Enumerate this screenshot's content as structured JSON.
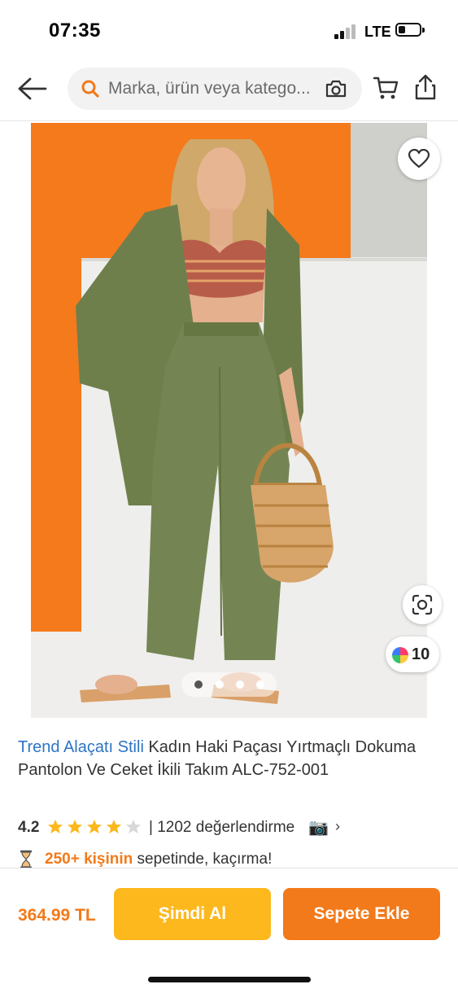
{
  "status_bar": {
    "time": "07:35",
    "network": "LTE"
  },
  "search": {
    "placeholder": "Marka, ürün veya katego..."
  },
  "icons": {
    "back": "arrow-left-icon",
    "search": "magnifier-icon",
    "visual_search": "camera-icon",
    "cart": "cart-icon",
    "share": "share-icon",
    "favorite": "heart-icon",
    "lens": "scan-icon"
  },
  "gallery": {
    "color_options_count": "10",
    "page_count": 4,
    "active_page": 1
  },
  "product": {
    "brand": "Trend Alaçatı Stili",
    "name": " Kadın Haki Paçası Yırtmaçlı Dokuma Pantolon Ve Ceket İkili Takım ALC-752-001",
    "rating": "4.2",
    "rating_value": 4.2,
    "reviews": "| 1202 değerlendirme",
    "basket_highlight": "250+ kişinin",
    "basket_text": " sepetinde, kaçırma!"
  },
  "bottom_bar": {
    "price": "364.99 TL",
    "buy_now_label": "Şimdi Al",
    "add_to_cart_label": "Sepete Ekle"
  },
  "colors": {
    "accent": "#f27a1a",
    "buy_now": "#fdb81e",
    "brand_link": "#2d74c4",
    "star": "#fdb81e"
  }
}
